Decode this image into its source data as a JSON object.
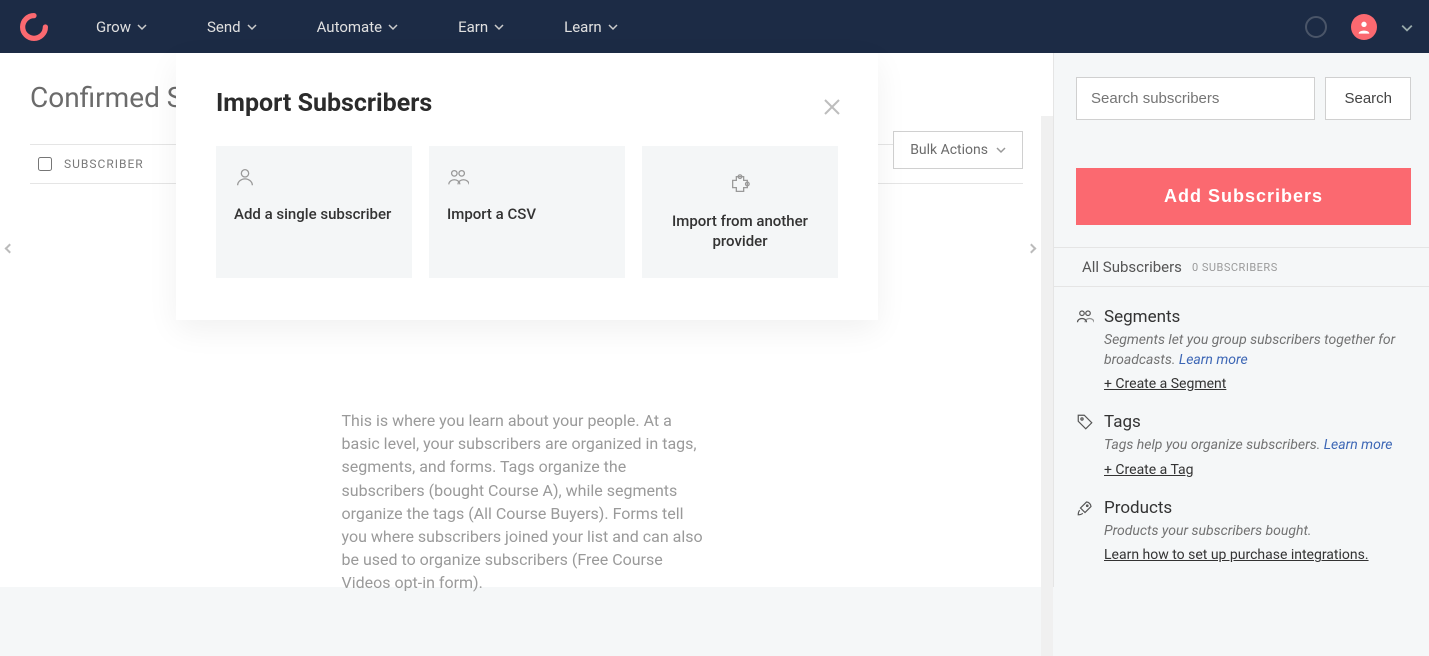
{
  "nav": {
    "items": [
      "Grow",
      "Send",
      "Automate",
      "Earn",
      "Learn"
    ]
  },
  "page": {
    "title": "Confirmed Subscribers",
    "table_header": "SUBSCRIBER",
    "bulk_actions": "Bulk Actions",
    "help_text": "This is where you learn about your people. At a basic level, your subscribers are organized in tags, segments, and forms. Tags organize the subscribers (bought Course A), while segments organize the tags (All Course Buyers). Forms tell you where subscribers joined your list and can also be used to organize subscribers (Free Course Videos opt-in form)."
  },
  "sidebar": {
    "search_placeholder": "Search subscribers",
    "search_button": "Search",
    "add_button": "Add Subscribers",
    "all_subscribers_label": "All Subscribers",
    "all_subscribers_count": "0 SUBSCRIBERS",
    "segments": {
      "title": "Segments",
      "desc": "Segments let you group subscribers together for broadcasts. ",
      "learn": "Learn more",
      "action": "+ Create a Segment"
    },
    "tags": {
      "title": "Tags",
      "desc": "Tags help you organize subscribers. ",
      "learn": "Learn more",
      "action": "+ Create a Tag"
    },
    "products": {
      "title": "Products",
      "desc": "Products your subscribers bought.",
      "action": "Learn how to set up purchase integrations."
    }
  },
  "modal": {
    "title": "Import Subscribers",
    "card1": "Add a single subscriber",
    "card2": "Import a CSV",
    "card3": "Import from another provider"
  }
}
